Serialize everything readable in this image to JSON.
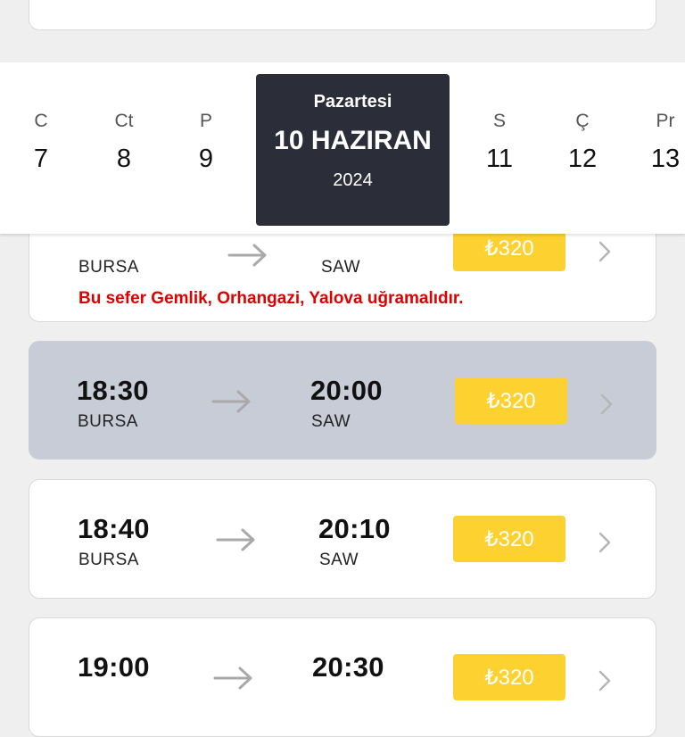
{
  "date_strip": {
    "days_before": [
      {
        "label": "C",
        "num": "7"
      },
      {
        "label": "Ct",
        "num": "8"
      },
      {
        "label": "P",
        "num": "9"
      }
    ],
    "selected": {
      "weekday": "Pazartesi",
      "date": "10 HAZIRAN",
      "year": "2024"
    },
    "days_after": [
      {
        "label": "S",
        "num": "11"
      },
      {
        "label": "Ç",
        "num": "12"
      },
      {
        "label": "Pr",
        "num": "13"
      }
    ]
  },
  "trips": [
    {
      "dep_city": "BURSA",
      "arr_city": "SAW",
      "price": "₺320",
      "note": "Bu sefer Gemlik, Orhangazi, Yalova uğramalıdır."
    },
    {
      "dep_time": "18:30",
      "dep_city": "BURSA",
      "arr_time": "20:00",
      "arr_city": "SAW",
      "price": "₺320"
    },
    {
      "dep_time": "18:40",
      "dep_city": "BURSA",
      "arr_time": "20:10",
      "arr_city": "SAW",
      "price": "₺320"
    },
    {
      "dep_time": "19:00",
      "arr_time": "20:30",
      "price": "₺320"
    }
  ],
  "colors": {
    "accent": "#fdd12f",
    "selected_date_bg": "#2b2d38",
    "selected_card_bg": "#c8ccd6",
    "note": "#e00000"
  },
  "icons": {
    "route_arrow": "arrow-right-icon",
    "open_trip": "chevron-right-icon"
  }
}
